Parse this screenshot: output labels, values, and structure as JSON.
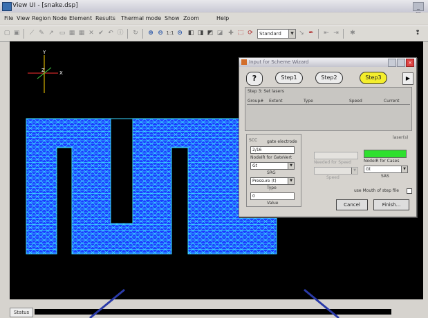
{
  "window": {
    "title": "View UI - [snake.dsp]",
    "controls": "_ □ ×"
  },
  "menubar": {
    "items": [
      "File",
      "View",
      "Region",
      "Node",
      "Element",
      "Results",
      "Thermal mode",
      "Show",
      "Zoom",
      "Help"
    ]
  },
  "toolbar": {
    "view_select": "Standard"
  },
  "axes": {
    "y": "Y",
    "z": "Z",
    "x": "X"
  },
  "dialog": {
    "title": "Input for Scheme Wizard",
    "help_label": "?",
    "steps": [
      {
        "label": "Step1",
        "active": false
      },
      {
        "label": "Step2",
        "active": false
      },
      {
        "label": "Step3",
        "active": true
      }
    ],
    "next_label": "▶",
    "list_caption": "Step 3: Set lasers",
    "list_columns": [
      "Group#",
      "Extent",
      "Type",
      "Speed",
      "Current"
    ],
    "panel_left": {
      "section_label": "SCC",
      "field_label": "gate electrode",
      "field_value": "2/16",
      "label_1": "NodeIR for GateVert",
      "select_1": "Gt",
      "label_2": "SRG",
      "select_2": "Pressure (t)",
      "label_3": "Type",
      "field_2_value": "0",
      "label_4": "Value"
    },
    "panel_right": {
      "section_label": "laser(s)",
      "disabled_label": "Needed for Speed",
      "label_node": "NodeIR for Cases",
      "select_node": "Gt",
      "sub_label": "SAS",
      "disabled_sub": "Speed"
    },
    "checkbox_label": "use Mouth of step file",
    "cancel_label": "Cancel",
    "finish_label": "Finish..."
  },
  "statusbar": {
    "tab_label": "Status"
  },
  "colors": {
    "mesh_fill": "#1d3bff",
    "mesh_line": "#39d8ff",
    "active_step": "#f4ee2c",
    "laser_indicator": "#2ee02e",
    "canvas_bg": "#000000"
  }
}
